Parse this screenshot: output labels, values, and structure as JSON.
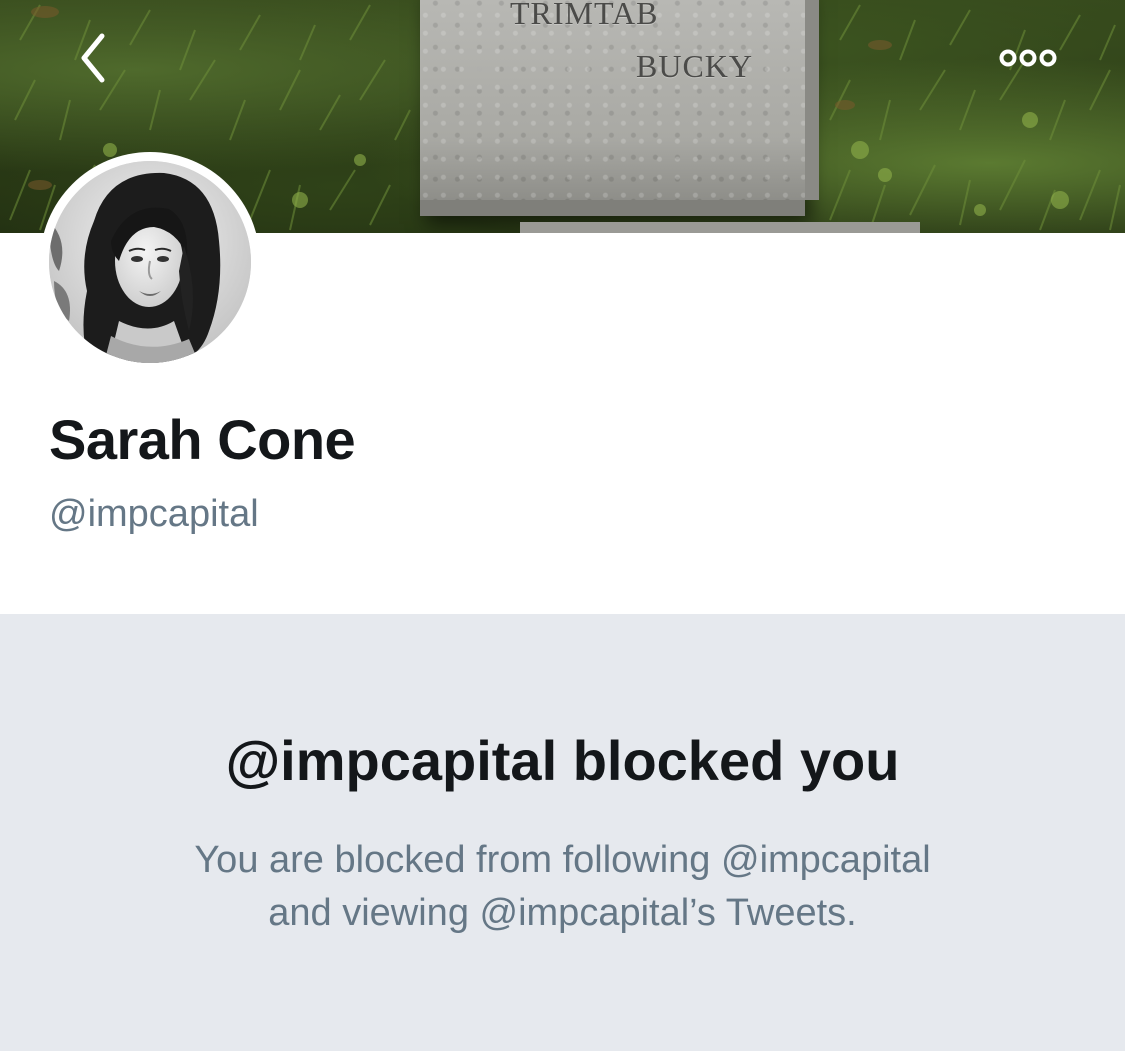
{
  "header": {
    "banner_engravings": [
      "TRIMTAB",
      "BUCKY"
    ],
    "back_icon": "chevron-left-icon",
    "more_icon": "more-options-icon"
  },
  "profile": {
    "display_name": "Sarah Cone",
    "handle": "@impcapital"
  },
  "blocked_notice": {
    "title": "@impcapital blocked you",
    "description_line_1": "You are blocked from following @impcapital",
    "description_line_2": "and viewing @impcapital’s Tweets."
  },
  "colors": {
    "text_primary": "#14171a",
    "text_secondary": "#657786",
    "panel_background": "#e6e9ee"
  }
}
